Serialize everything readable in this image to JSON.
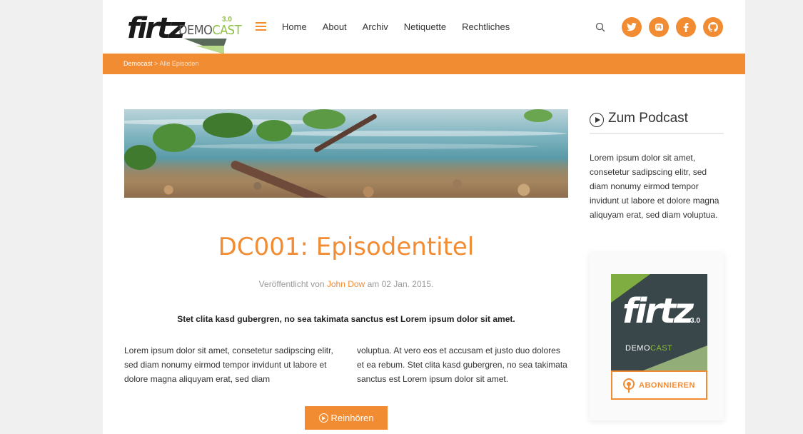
{
  "header": {
    "logo_text": "firtz",
    "logo_sub_demo": "DEMO",
    "logo_sub_cast": "CAST",
    "logo_version": "3.0",
    "nav": [
      "Home",
      "About",
      "Archiv",
      "Netiquette",
      "Rechtliches"
    ],
    "social": [
      {
        "name": "twitter",
        "glyph": "t"
      },
      {
        "name": "mastodon",
        "glyph": "m"
      },
      {
        "name": "facebook",
        "glyph": "f"
      },
      {
        "name": "github",
        "glyph": "g"
      }
    ]
  },
  "breadcrumb": {
    "root": "Democast",
    "separator": ">",
    "current": "Alle Episoden"
  },
  "episode": {
    "title": "DC001: Episodentitel",
    "meta_prefix": "Veröffentlicht von",
    "author": "John Dow",
    "meta_mid": "am",
    "date": "02 Jan. 2015.",
    "lead": "Stet clita kasd gubergren, no sea takimata sanctus est Lorem ipsum dolor sit amet.",
    "col1": "Lorem ipsum dolor sit amet, consetetur sadipscing elitr, sed diam nonumy eirmod tempor invidunt ut labore et dolore magna aliquyam erat, sed diam",
    "col2": "voluptua. At vero eos et accusam et justo duo dolores et ea rebum. Stet clita kasd gubergren, no sea takimata sanctus est Lorem ipsum dolor sit amet.",
    "listen_label": "Reinhören"
  },
  "sidebar": {
    "title": "Zum Podcast",
    "text": "Lorem ipsum dolor sit amet, consetetur sadipscing elitr, sed diam nonumy eirmod tempor invidunt ut labore et dolore magna aliquyam erat, sed diam voluptua.",
    "cover_title": "firtz",
    "cover_version": "3.0",
    "cover_demo": "DEMO",
    "cover_cast": "CAST",
    "subscribe_label": "ABONNIEREN"
  },
  "colors": {
    "accent": "#f28c33",
    "brand_green": "#8cbf3f"
  }
}
